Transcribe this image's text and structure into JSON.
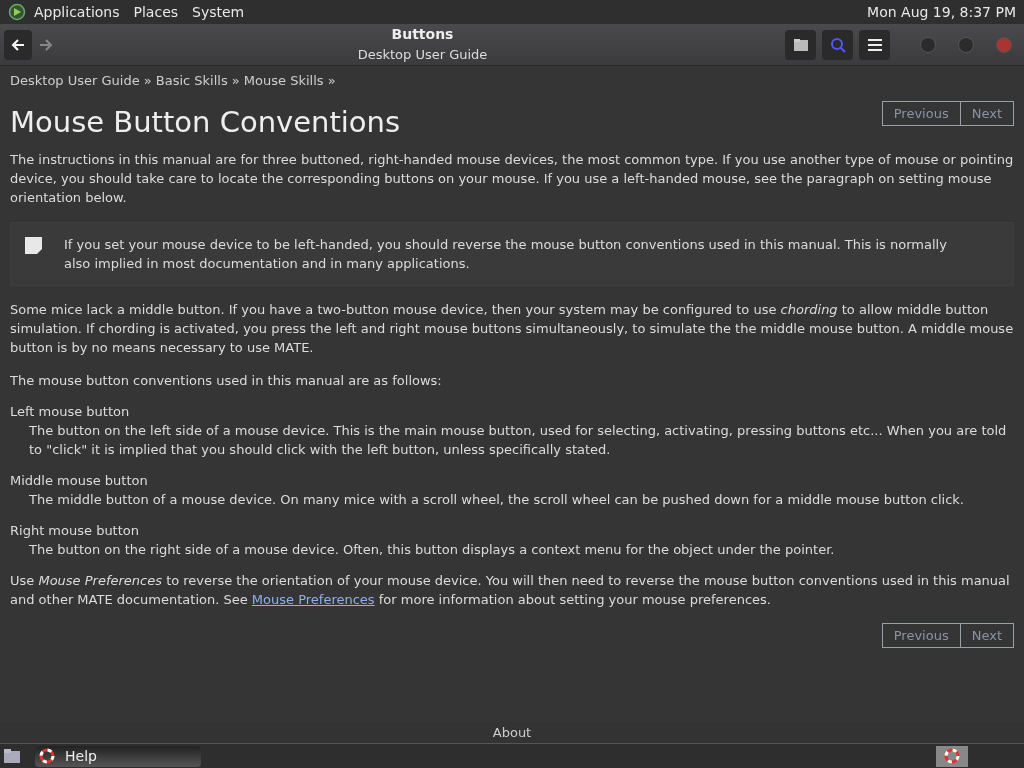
{
  "top_panel": {
    "menus": [
      "Applications",
      "Places",
      "System"
    ],
    "clock": "Mon Aug 19,  8:37 PM"
  },
  "header": {
    "title": "Buttons",
    "subtitle": "Desktop User Guide"
  },
  "breadcrumbs": [
    "Desktop User Guide »",
    "Basic Skills »",
    "Mouse Skills »"
  ],
  "page_title": "Mouse Button Conventions",
  "nav_top": [
    "Previous",
    "Next"
  ],
  "intro": "The instructions in this manual are for three buttoned, right-handed mouse devices, the most common type. If you use another type of mouse or pointing device, you should take care to locate the corresponding buttons on your mouse. If you use a left-handed mouse, see the paragraph on setting mouse orientation below.",
  "note": "If you set your mouse device to be left-handed, you should reverse the mouse button conventions used in this manual. This is normally also implied in most documentation and in many applications.",
  "paragraphs": [
    "Some mice lack a middle button. If you have a two-button mouse device, then your system may be configured to use *chording* to allow middle button simulation. If chording is activated, you press the left and right mouse buttons simultaneously, to simulate the the middle mouse button. A middle mouse button is by no means necessary to use MATE.",
    "The mouse button conventions used in this manual are as follows:"
  ],
  "definitions": [
    {
      "term": "Left mouse button",
      "desc": "The button on the left side of a mouse device. This is the main mouse button, used for selecting, activating, pressing buttons etc... When you are told to \"click\" it is implied that you should click with the left button, unless specifically stated."
    },
    {
      "term": "Middle mouse button",
      "desc": "The middle button of a mouse device. On many mice with a scroll wheel, the scroll wheel can be pushed down for a middle mouse button click."
    },
    {
      "term": "Right mouse button",
      "desc": "The button on the right side of a mouse device. Often, this button displays a context menu for the object under the pointer."
    }
  ],
  "final_paragraph": [
    {
      "kind": "text",
      "text": "Use *Mouse Preferences* to reverse the orientation of your mouse device. You will then need to reverse the mouse button conventions used in this manual and other MATE documentation. See "
    },
    {
      "kind": "link",
      "text": "Mouse Preferences"
    },
    {
      "kind": "text",
      "text": " for more information about setting your mouse preferences."
    }
  ],
  "nav_bottom": [
    "Previous",
    "Next"
  ],
  "footer": "About",
  "taskbar": {
    "task": "Help"
  }
}
